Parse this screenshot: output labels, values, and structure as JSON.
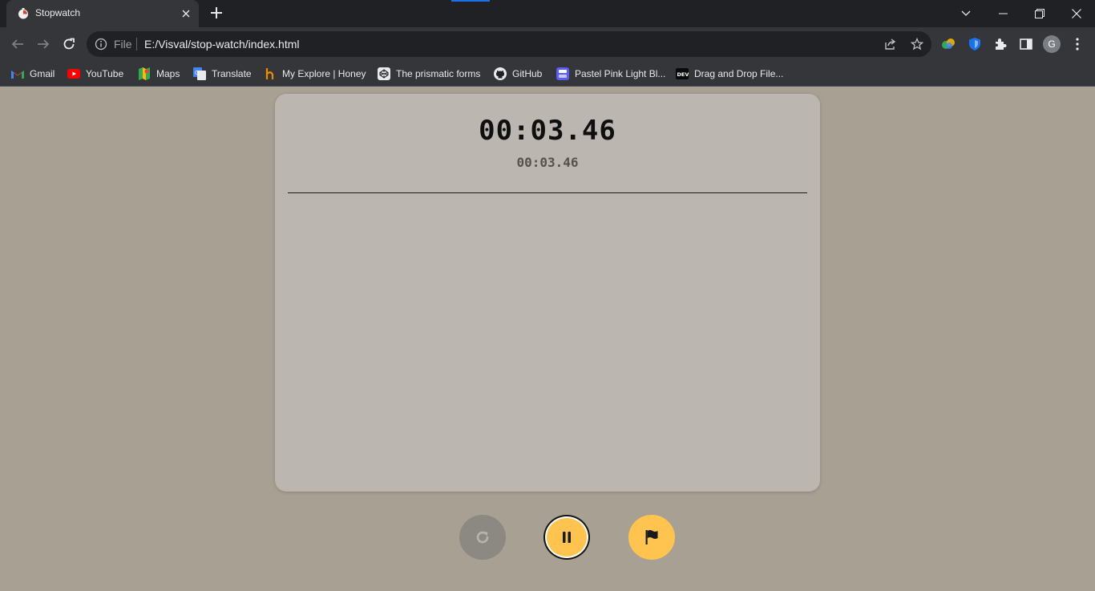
{
  "browser": {
    "tab_title": "Stopwatch",
    "address": {
      "scheme_label": "File",
      "url": "E:/Visval/stop-watch/index.html"
    },
    "bookmarks": [
      {
        "label": "Gmail",
        "icon": "gmail-icon"
      },
      {
        "label": "YouTube",
        "icon": "youtube-icon"
      },
      {
        "label": "Maps",
        "icon": "maps-icon"
      },
      {
        "label": "Translate",
        "icon": "translate-icon"
      },
      {
        "label": "My Explore | Honey",
        "icon": "honey-icon"
      },
      {
        "label": "The prismatic forms",
        "icon": "codepen-icon"
      },
      {
        "label": "GitHub",
        "icon": "github-icon"
      },
      {
        "label": "Pastel Pink Light Bl...",
        "icon": "palette-icon"
      },
      {
        "label": "Drag and Drop File...",
        "icon": "dev-icon"
      }
    ],
    "profile_initial": "G",
    "accent_color": "#1a73e8"
  },
  "stopwatch": {
    "main_time": "00:03.46",
    "lap_time": "00:03.46",
    "laps": [],
    "controls": {
      "reset": {
        "icon": "reset-icon",
        "color": "#8c8882"
      },
      "pause": {
        "icon": "pause-icon",
        "color": "#ffc350"
      },
      "lap": {
        "icon": "flag-icon",
        "color": "#ffc350"
      }
    },
    "colors": {
      "page_background": "#a8a093",
      "card_background": "#bbb6af"
    }
  }
}
